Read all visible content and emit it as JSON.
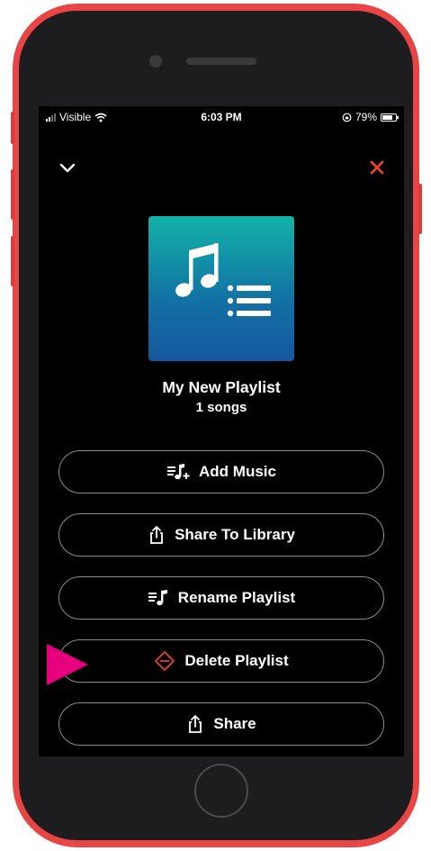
{
  "status_bar": {
    "carrier": "Visible",
    "time": "6:03 PM",
    "battery": "79%",
    "battery_level": 0.79
  },
  "header": {
    "collapse_icon": "chevron-down-icon",
    "close_icon": "close-icon"
  },
  "playlist": {
    "artwork_icon": "music-playlist-icon",
    "title": "My New Playlist",
    "song_count": "1 songs"
  },
  "actions": [
    {
      "label": "Add Music",
      "icon": "add-music-icon"
    },
    {
      "label": "Share To Library",
      "icon": "share-icon"
    },
    {
      "label": "Rename Playlist",
      "icon": "rename-playlist-icon"
    },
    {
      "label": "Delete Playlist",
      "icon": "delete-icon"
    },
    {
      "label": "Share",
      "icon": "share-icon"
    }
  ],
  "colors": {
    "phone_frame": "#e84545",
    "close_accent": "#e8412e",
    "delete_accent": "#e8412e",
    "pointer": "#e6007e",
    "artwork_top": "#13b3a8",
    "artwork_bottom": "#1556a0"
  }
}
